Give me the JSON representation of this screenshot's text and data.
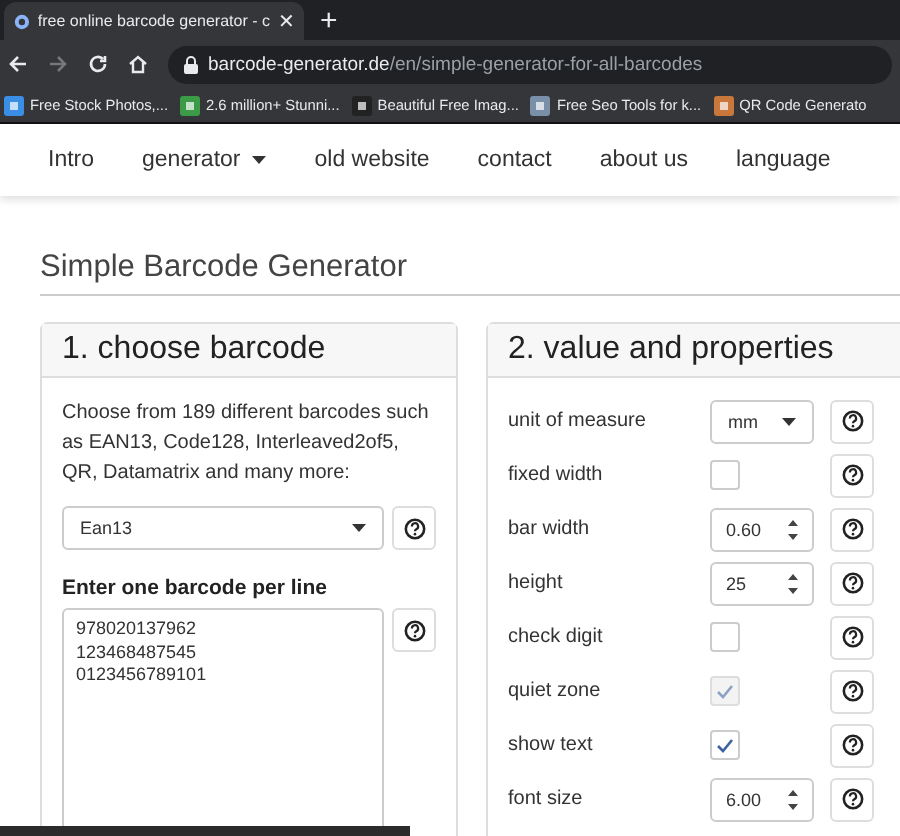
{
  "browser": {
    "tab_title": "free online barcode generator - c",
    "tab_close": "✕",
    "new_tab": "+",
    "url_domain": "barcode-generator.de",
    "url_path": "/en/simple-generator-for-all-barcodes",
    "bookmarks": [
      "Free Stock Photos,...",
      "2.6 million+ Stunni...",
      "Beautiful Free Imag...",
      "Free Seo Tools for k...",
      "QR Code Generato"
    ]
  },
  "nav": [
    {
      "label": "Intro",
      "dropdown": false
    },
    {
      "label": "generator",
      "dropdown": true
    },
    {
      "label": "old website",
      "dropdown": false
    },
    {
      "label": "contact",
      "dropdown": false
    },
    {
      "label": "about us",
      "dropdown": false
    },
    {
      "label": "language",
      "dropdown": false
    }
  ],
  "page_title": "Simple Barcode Generator",
  "choose": {
    "title": "1. choose barcode",
    "description": "Choose from 189 different barcodes such as EAN13, Code128, Interleaved2of5, QR, Datamatrix and many more:",
    "barcode_type": "Ean13",
    "input_label": "Enter one barcode per line",
    "input_value": "978020137962\n123468487545\n0123456789101"
  },
  "properties": {
    "title": "2. value and properties",
    "rows": [
      {
        "label": "unit of measure",
        "kind": "select",
        "value": "mm"
      },
      {
        "label": "fixed width",
        "kind": "checkbox",
        "checked": false,
        "disabled": false
      },
      {
        "label": "bar width",
        "kind": "number",
        "value": "0.60"
      },
      {
        "label": "height",
        "kind": "number",
        "value": "25"
      },
      {
        "label": "check digit",
        "kind": "checkbox",
        "checked": false,
        "disabled": false
      },
      {
        "label": "quiet zone",
        "kind": "checkbox",
        "checked": true,
        "disabled": true
      },
      {
        "label": "show text",
        "kind": "checkbox",
        "checked": true,
        "disabled": false
      },
      {
        "label": "font size",
        "kind": "number",
        "value": "6.00"
      }
    ]
  }
}
